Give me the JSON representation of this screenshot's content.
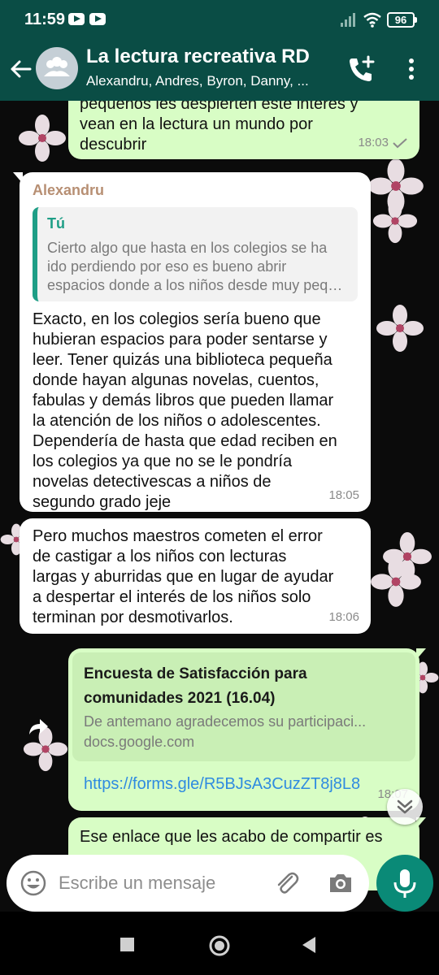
{
  "status_bar": {
    "time": "11:59",
    "battery": "96"
  },
  "header": {
    "title": "La lectura recreativa RD",
    "members": "Alexandru, Andres, Byron, Danny, ..."
  },
  "messages": [
    {
      "text": "pequeños les despierten este interés y\nvean en la lectura un mundo por\ndescubrir",
      "time": "18:03"
    },
    {
      "sender": "Alexandru",
      "quote_author": "Tú",
      "quote_text": "Cierto algo que hasta en los colegios se ha ido perdiendo por eso es bueno abrir espacios donde a los niños desde muy peq…",
      "text": "Exacto, en los colegios sería bueno que\nhubieran espacios para poder sentarse y\nleer. Tener quizás una biblioteca pequeña\ndonde hayan algunas novelas, cuentos,\nfabulas y demás libros que pueden llamar\nla atención de los niños o adolescentes.\nDependería de hasta que edad reciben en\nlos colegios ya que no se le pondría\nnovelas detectivescas a niños de\nsegundo grado jeje",
      "time": "18:05"
    },
    {
      "text": "Pero muchos maestros cometen el error\nde castigar a los niños con lecturas\nlargas y aburridas que en lugar de ayudar\na despertar el interés de los niños solo\nterminan por desmotivarlos.",
      "time": "18:06"
    },
    {
      "link_title": "Encuesta de Satisfacción para\ncomunidades 2021 (16.04)",
      "link_desc": "De antemano agradecemos su participaci...",
      "link_domain": "docs.google.com",
      "link_url": "https://forms.gle/R5BJsA3CuzZT8j8L8",
      "time": "18:07"
    },
    {
      "text": "Ese enlace que les acabo de compartir es"
    }
  ],
  "composer": {
    "placeholder": "Escribe un mensaje"
  },
  "colors": {
    "header": "#0a4d45",
    "accent": "#0a8a77",
    "outgoing": "#d8fdc5",
    "incoming": "#ffffff",
    "link": "#2f8be0"
  },
  "icons": [
    "back-arrow",
    "group-avatar",
    "add-call",
    "more-vert",
    "read-check",
    "forward",
    "double-chevron-down",
    "emoji",
    "paperclip",
    "camera",
    "microphone",
    "nav-square",
    "nav-circle",
    "nav-triangle"
  ]
}
